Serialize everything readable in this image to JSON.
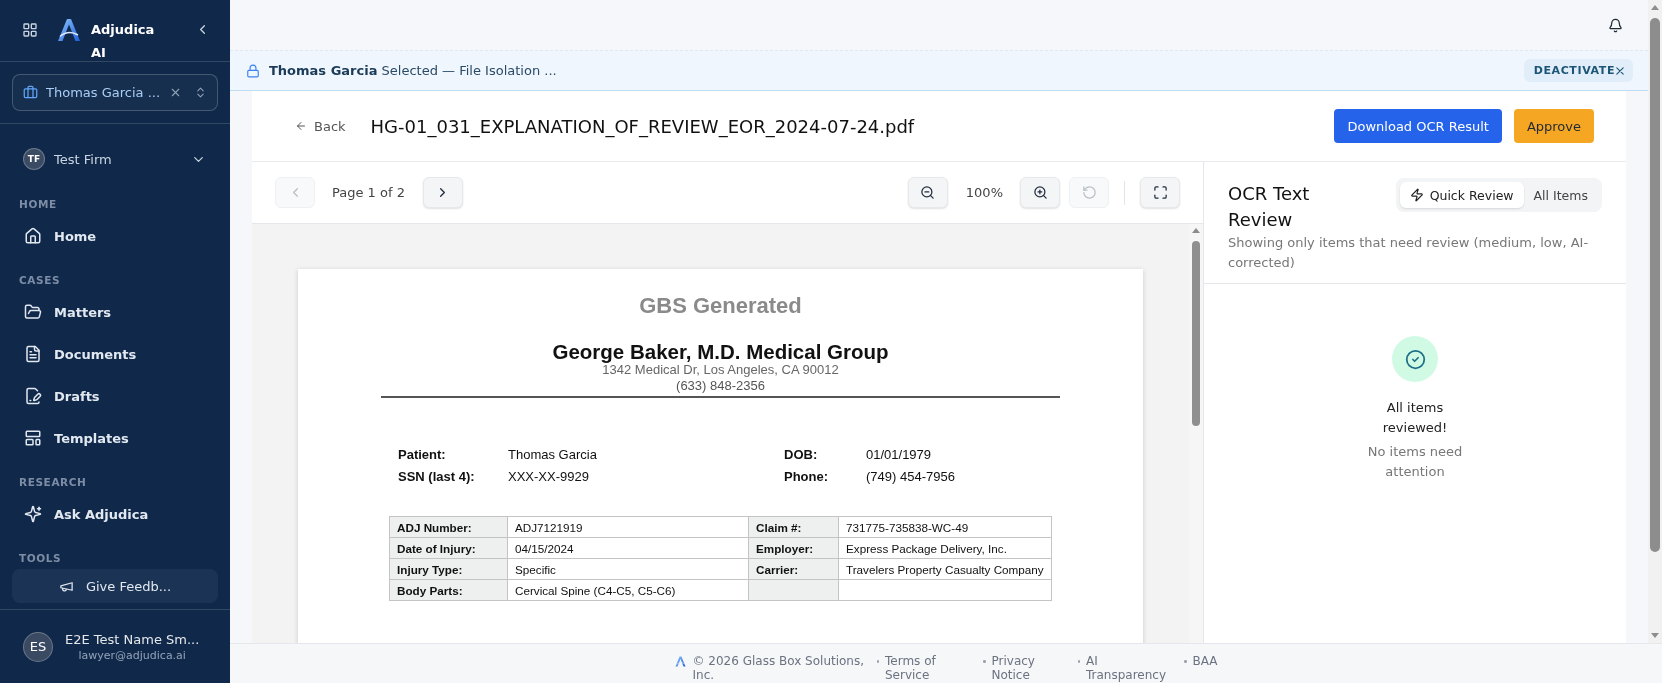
{
  "sidebar": {
    "brand": "Adjudica AI",
    "matter_selector": {
      "value": "Thomas Garcia ..."
    },
    "firm": {
      "initials": "TF",
      "name": "Test Firm"
    },
    "sections": [
      {
        "label": "HOME",
        "items": [
          {
            "label": "Home",
            "selected": false
          }
        ]
      },
      {
        "label": "CASES",
        "items": [
          {
            "label": "Matters",
            "selected": false
          },
          {
            "label": "Documents",
            "selected": false
          },
          {
            "label": "Drafts",
            "selected": false
          },
          {
            "label": "Templates",
            "selected": false
          }
        ]
      },
      {
        "label": "RESEARCH",
        "items": [
          {
            "label": "Ask Adjudica",
            "selected": false
          }
        ]
      }
    ],
    "tools": {
      "label": "TOOLS",
      "button": "Give Feedb..."
    },
    "user": {
      "initials": "ES",
      "name": "E2E Test Name Sm...",
      "email": "lawyer@adjudica.ai"
    }
  },
  "banner": {
    "text": "**Thomas Garcia** Selected — File Isolation ...",
    "action": "DEACTIVATE"
  },
  "header": {
    "back": "Back",
    "filename": "HG-01_031_EXPLANATION_OF_REVIEW_EOR_2024-07-24.pdf",
    "buttons": [
      {
        "label": "Download OCR Result",
        "kind": "primary"
      },
      {
        "label": "Approve",
        "kind": "approve"
      }
    ]
  },
  "viewer": {
    "toolbar": {
      "prev": {
        "disabled": true
      },
      "page": "Page 1 of 2",
      "next": {
        "disabled": false
      },
      "zoom_out": {
        "disabled": false
      },
      "zoom": "100%",
      "zoom_in": {
        "disabled": false
      },
      "rotate": {
        "disabled": true
      },
      "fullscreen": {
        "disabled": false
      }
    },
    "document": {
      "header_note": "GBS Generated",
      "practice": "George Baker, M.D. Medical Group",
      "address": "1342 Medical Dr, Los Angeles, CA 90012",
      "phone": "(633) 848-2356",
      "patient_fields": [
        {
          "label": "Patient:",
          "value": "Thomas Garcia"
        },
        {
          "label": "DOB:",
          "value": "01/01/1979"
        },
        {
          "label": "SSN (last 4):",
          "value": "XXX-XX-9929"
        },
        {
          "label": "Phone:",
          "value": "(749) 454-7956"
        }
      ],
      "table": [
        {
          "label_1": "ADJ Number:",
          "value_1": "ADJ7121919",
          "label_2": "Claim #:",
          "value_2": "731775-735838-WC-49"
        },
        {
          "label_1": "Date of Injury:",
          "value_1": "04/15/2024",
          "label_2": "Employer:",
          "value_2": "Express Package Delivery, Inc."
        },
        {
          "label_1": "Injury Type:",
          "value_1": "Specific",
          "label_2": "Carrier:",
          "value_2": "Travelers Property Casualty Company"
        },
        {
          "label_1": "Body Parts:",
          "value_1": "Cervical Spine (C4-C5, C5-C6)"
        }
      ]
    }
  },
  "review_panel": {
    "title": "OCR Text Review",
    "tabs": [
      {
        "label": "Quick Review",
        "kind": "quick",
        "selected": true
      },
      {
        "label": "All Items",
        "kind": "all",
        "selected": false
      }
    ],
    "description": "Showing only items that need review (medium, low, AI-corrected)",
    "empty_state": {
      "title": "All items reviewed!",
      "message": "No items need attention"
    }
  },
  "footer": {
    "copyright": "© 2026 Glass Box Solutions, Inc.",
    "links": [
      "Terms of Service",
      "Privacy Notice",
      "AI Transparency",
      "BAA"
    ]
  }
}
